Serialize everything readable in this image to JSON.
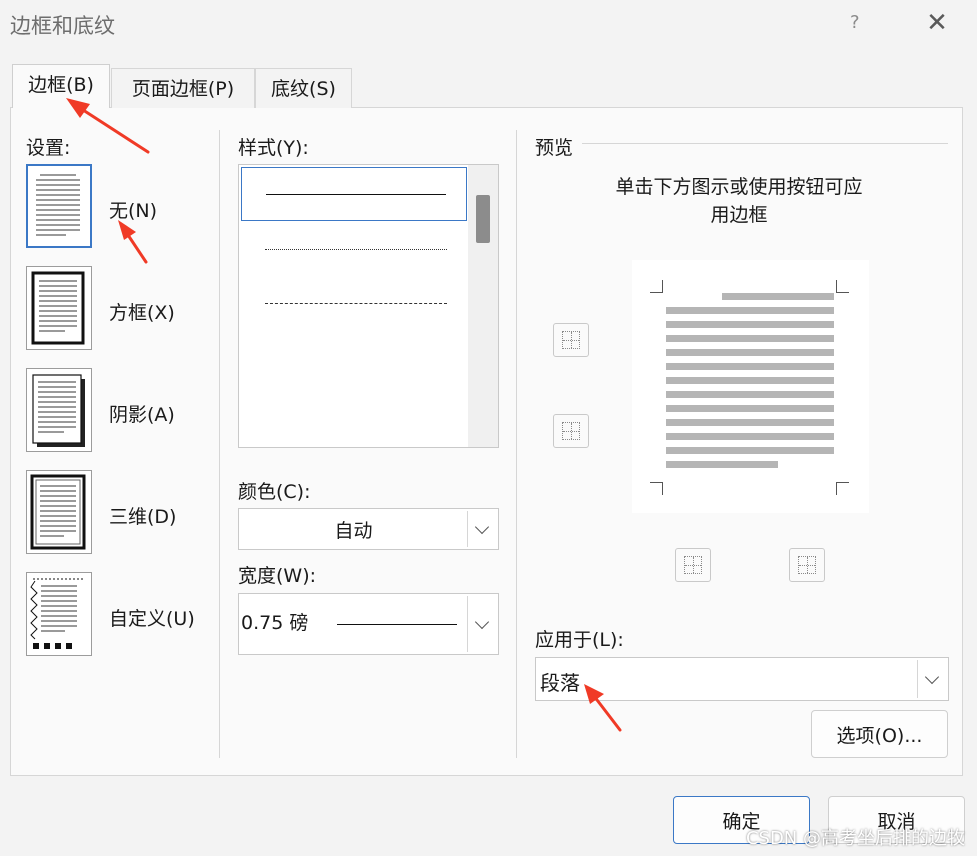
{
  "window": {
    "title": "边框和底纹",
    "help": "?",
    "close": "✕"
  },
  "tabs": [
    {
      "label": "边框(B)",
      "active": true
    },
    {
      "label": "页面边框(P)",
      "active": false
    },
    {
      "label": "底纹(S)",
      "active": false
    }
  ],
  "settings": {
    "heading": "设置:",
    "items": [
      {
        "label": "无(N)",
        "selected": true
      },
      {
        "label": "方框(X)",
        "selected": false
      },
      {
        "label": "阴影(A)",
        "selected": false
      },
      {
        "label": "三维(D)",
        "selected": false
      },
      {
        "label": "自定义(U)",
        "selected": false
      }
    ]
  },
  "style": {
    "heading": "样式(Y):",
    "items": [
      "solid",
      "dotted",
      "dashed-fine",
      "dashed",
      "dash-dot"
    ]
  },
  "color": {
    "heading": "颜色(C):",
    "value": "自动"
  },
  "width": {
    "heading": "宽度(W):",
    "value": "0.75 磅"
  },
  "preview": {
    "heading": "预览",
    "hint_line1": "单击下方图示或使用按钮可应",
    "hint_line2": "用边框"
  },
  "apply_to": {
    "heading": "应用于(L):",
    "value": "段落"
  },
  "buttons": {
    "options": "选项(O)...",
    "ok": "确定",
    "cancel": "取消"
  },
  "watermark": "CSDN @高考坐后排的边牧",
  "colors": {
    "accent": "#3b78c6",
    "annotation_arrow": "#f03a26"
  }
}
